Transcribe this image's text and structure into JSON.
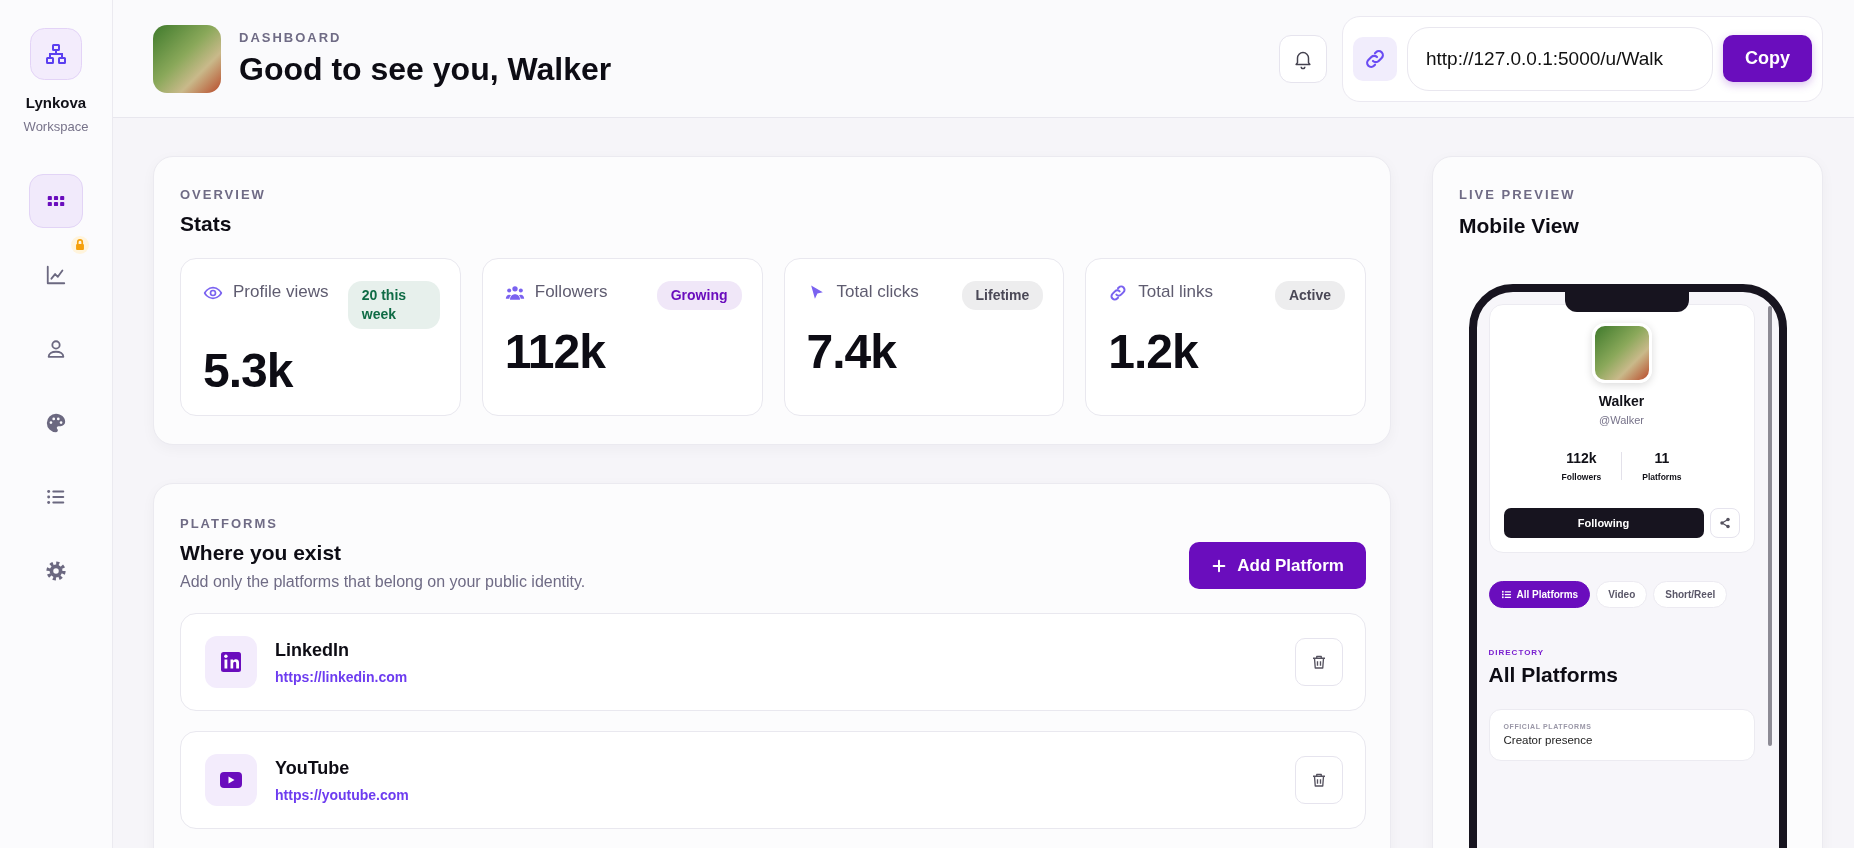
{
  "sidebar": {
    "brand": "Lynkova",
    "subtitle": "Workspace",
    "nav": [
      {
        "selected": true,
        "locked": false
      },
      {
        "selected": false,
        "locked": true
      },
      {
        "selected": false,
        "locked": false
      },
      {
        "selected": false,
        "locked": false
      },
      {
        "selected": false,
        "locked": false
      },
      {
        "selected": false,
        "locked": false
      }
    ]
  },
  "header": {
    "eyebrow": "DASHBOARD",
    "title": "Good to see you, Walker",
    "share_link": {
      "value": "http://127.0.0.1:5000/u/Walk",
      "button": "Copy"
    }
  },
  "stats": {
    "eyebrow": "OVERVIEW",
    "title": "Stats",
    "items": [
      {
        "label": "Profile views",
        "value": "5.3k",
        "badge": {
          "text": "20 this week",
          "color": "#0f6b45"
        }
      },
      {
        "label": "Followers",
        "value": "112k",
        "badge": {
          "text": "Growing",
          "color": "#6a0dbd"
        }
      },
      {
        "label": "Total clicks",
        "value": "7.4k",
        "badge": {
          "text": "Lifetime",
          "color": "#4a4856"
        }
      },
      {
        "label": "Total links",
        "value": "1.2k",
        "badge": {
          "text": "Active",
          "color": "#4a4856"
        }
      }
    ]
  },
  "platforms": {
    "eyebrow": "PLATFORMS",
    "title": "Where you exist",
    "subtitle": "Add only the platforms that belong on your public identity.",
    "add_button": "Add Platform",
    "items": [
      {
        "name": "LinkedIn",
        "url": "https://linkedin.com"
      },
      {
        "name": "YouTube",
        "url": "https://youtube.com"
      }
    ]
  },
  "preview": {
    "eyebrow": "LIVE PREVIEW",
    "title": "Mobile View",
    "profile": {
      "name": "Walker",
      "handle": "@Walker",
      "stats": [
        {
          "value": "112k",
          "label": "Followers"
        },
        {
          "value": "11",
          "label": "Platforms"
        }
      ],
      "follow_button": "Following"
    },
    "filters": [
      {
        "label": "All Platforms",
        "selected": true
      },
      {
        "label": "Video",
        "selected": false
      },
      {
        "label": "Short/Reel",
        "selected": false
      }
    ],
    "directory": {
      "eyebrow": "DIRECTORY",
      "title": "All Platforms",
      "cards": [
        {
          "eyebrow": "OFFICIAL PLATFORMS",
          "text": "Creator presence"
        }
      ]
    }
  }
}
